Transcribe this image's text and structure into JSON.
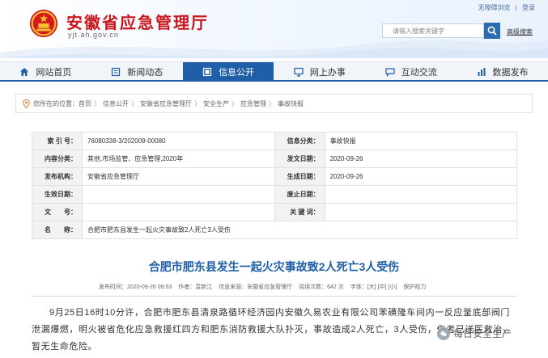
{
  "header": {
    "site_name": "安徽省应急管理厅",
    "site_domain": "yjt.ah.gov.cn",
    "toplinks": [
      "无障碍浏览",
      "|",
      "登录"
    ],
    "search_placeholder": "请输入搜索关键字",
    "advanced_search": "高级搜索"
  },
  "nav": [
    {
      "label": "网站首页",
      "icon": "home-icon"
    },
    {
      "label": "新闻动态",
      "icon": "news-icon"
    },
    {
      "label": "信息公开",
      "icon": "info-icon",
      "active": true
    },
    {
      "label": "网上办事",
      "icon": "monitor-icon"
    },
    {
      "label": "互动交流",
      "icon": "chat-icon"
    },
    {
      "label": "数据发布",
      "icon": "chart-icon"
    }
  ],
  "breadcrumb": {
    "prefix": "您所在的位置：",
    "items": [
      "首页",
      "信息公开",
      "安徽省应急管理厅",
      "安全生产",
      "应急管理",
      "事故快报"
    ]
  },
  "info": {
    "rows": [
      {
        "l1": "索 引 号：",
        "v1": "76080338-3/202009-00080",
        "l2": "信息分类：",
        "v2": "事故快报"
      },
      {
        "l1": "内容分类：",
        "v1": "其他,市场监管、应急管理,2020年",
        "l2": "发文日期：",
        "v2": "2020-09-26"
      },
      {
        "l1": "发布机构：",
        "v1": "安徽省应急管理厅",
        "l2": "生成日期：",
        "v2": "2020-09-26"
      },
      {
        "l1": "生效日期：",
        "v1": "",
        "l2": "废止日期：",
        "v2": ""
      },
      {
        "l1": "文　　号：",
        "v1": "",
        "l2": "关 键 词：",
        "v2": ""
      }
    ],
    "name_label": "名　　称：",
    "name_value": "合肥市肥东县发生一起火灾事故致2人死亡3人受伤"
  },
  "article": {
    "title": "合肥市肥东县发生一起火灾事故致2人死亡3人受伤",
    "meta": {
      "published": "发布时间：2020-09-26 09:53",
      "author": "作者：袁新江",
      "source": "信息来源：安徽省应急管理厅",
      "views": "阅读次数：642 次",
      "font": "字体：[大] [中] [小]",
      "eye": "保护视力"
    },
    "body": "9月25日16时10分许，合肥市肥东县清泉路循环经济园内安徽久易农业有限公司苯磺隆车间内一反应釜底部阀门泄漏爆燃，明火被省危化应急救援红四方和肥东消防救援大队扑灭，事故造成2人死亡，3人受伤，伤者已送医救治，暂无生命危险。"
  },
  "watermark": "每日安全生产",
  "colors": {
    "brand_red": "#c8161d",
    "brand_blue": "#1f5fa8",
    "title_blue": "#1e5fa8"
  }
}
